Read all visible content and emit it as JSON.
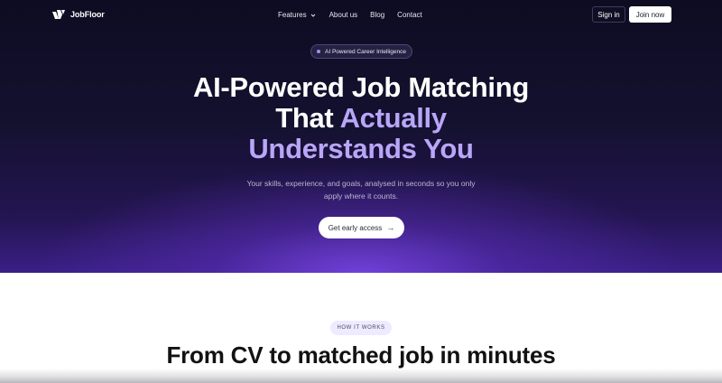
{
  "nav": {
    "brand": "JobFloor",
    "links": [
      {
        "label": "Features",
        "has_dropdown": true
      },
      {
        "label": "About us"
      },
      {
        "label": "Blog"
      },
      {
        "label": "Contact"
      }
    ],
    "sign_in": "Sign in",
    "join_now": "Join now"
  },
  "hero": {
    "badge": "AI Powered Career Intelligence",
    "headline_line1": "AI-Powered Job Matching",
    "headline_line2_plain": "That ",
    "headline_line2_accent": "Actually",
    "headline_line3_accent": "Understands You",
    "subtitle": "Your skills, experience, and goals, analysed in seconds so you only apply where it counts.",
    "cta": "Get early access",
    "cta_arrow": "→"
  },
  "how": {
    "pill": "HOW IT WORKS",
    "title": "From CV to matched job in minutes"
  },
  "colors": {
    "hero_dark": "#0d0c22",
    "hero_purple": "#3a1f86",
    "accent_text": "#b9a6f8",
    "pill_bg": "#eeeaff"
  },
  "icons": {
    "logo": "jobfloor-logo-icon",
    "dropdown": "chevron-down-icon",
    "cta_arrow": "arrow-right-icon"
  }
}
